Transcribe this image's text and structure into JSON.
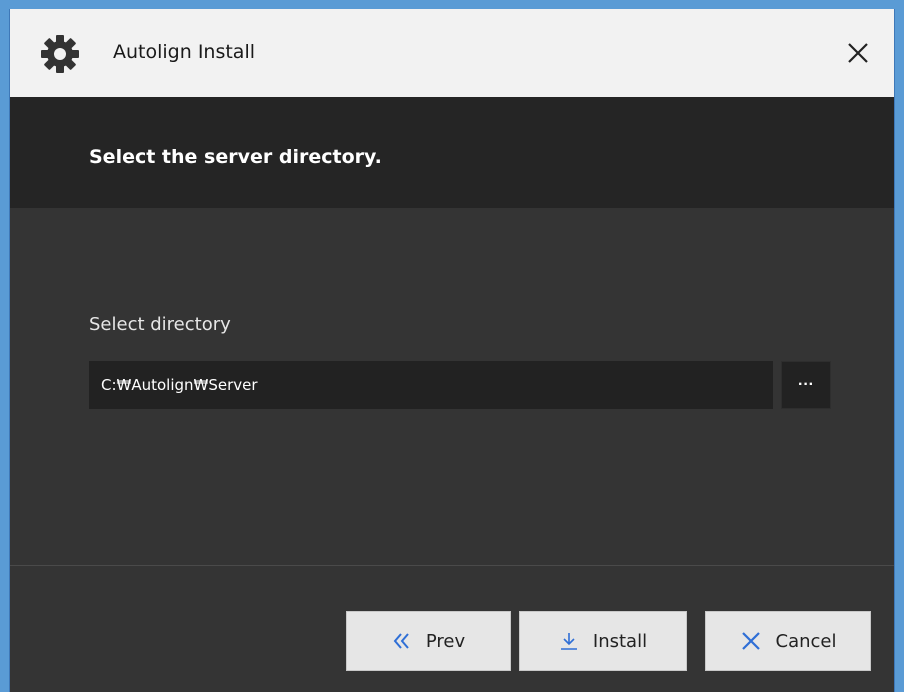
{
  "window": {
    "title": "Autolign Install",
    "icons": {
      "app": "gear-icon",
      "close": "close-icon"
    }
  },
  "header": {
    "text": "Select the server directory."
  },
  "content": {
    "label": "Select directory",
    "directory_value": "C:₩Autolign₩Server",
    "browse_label": "···"
  },
  "footer": {
    "prev_label": "Prev",
    "install_label": "Install",
    "cancel_label": "Cancel"
  },
  "colors": {
    "accent_blue": "#2f6fd6",
    "header_bg": "#252525",
    "content_bg": "#343434",
    "input_bg": "#222222",
    "button_bg": "#e6e6e6"
  }
}
